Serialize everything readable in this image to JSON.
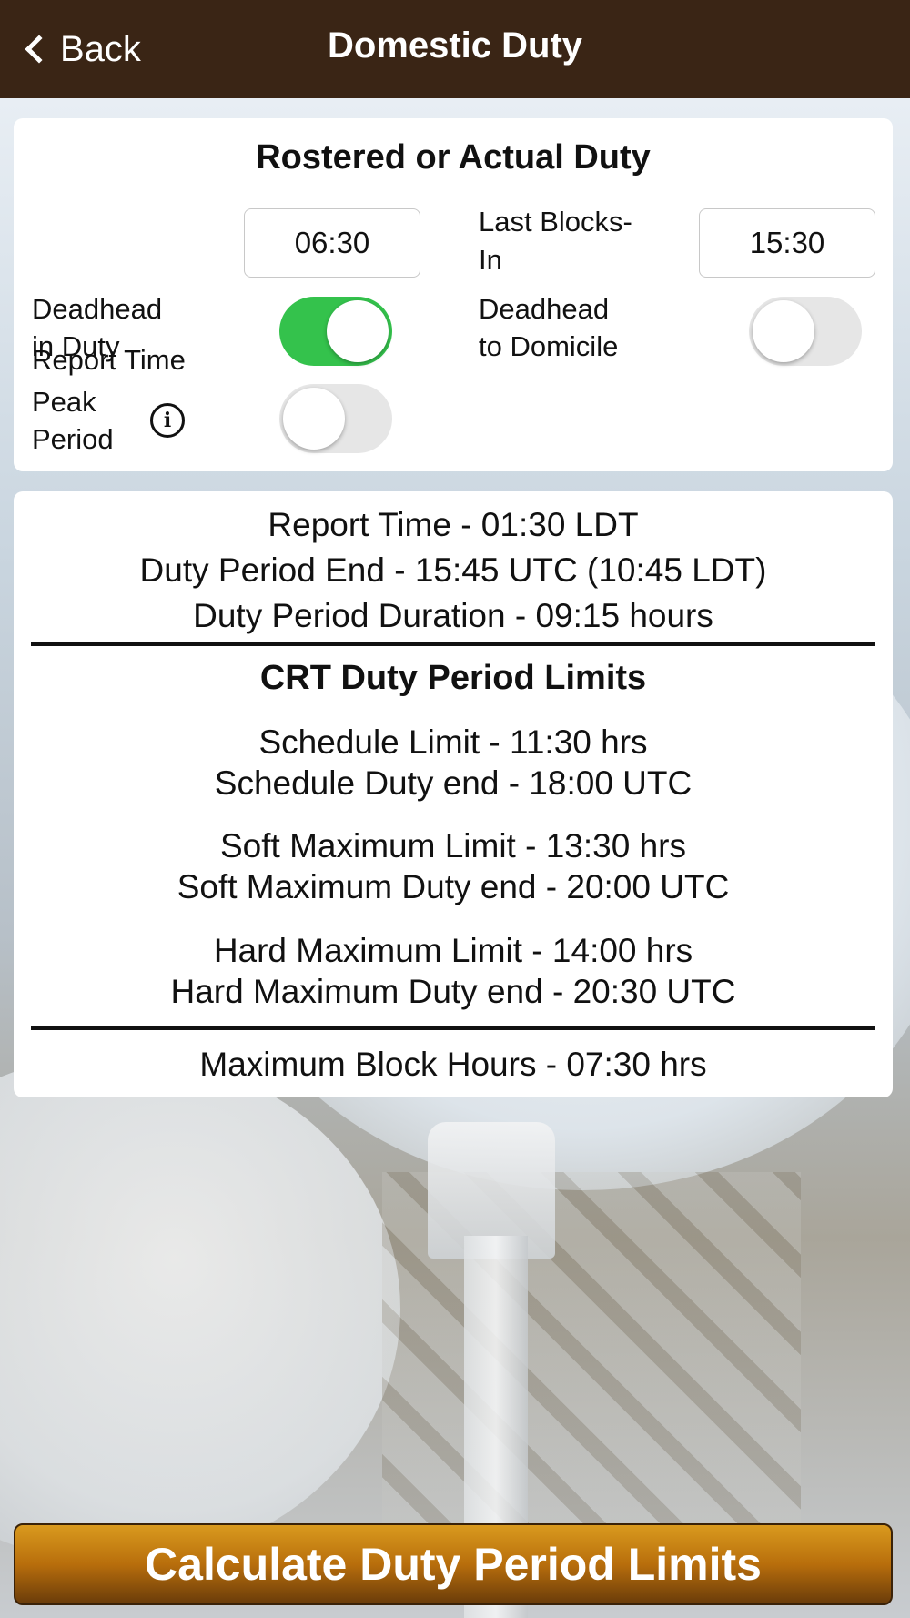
{
  "nav": {
    "back_label": "Back",
    "title": "Domestic Duty"
  },
  "input_card": {
    "title": "Rostered or Actual Duty",
    "report_time_label": "Report Time",
    "report_time_value": "06:30",
    "last_blocks_in_label_1": "Last Blocks-",
    "last_blocks_in_label_2": "In",
    "last_blocks_in_value": "15:30",
    "deadhead_in_duty_label_1": "Deadhead",
    "deadhead_in_duty_label_2": "in Duty",
    "deadhead_in_duty_on": true,
    "deadhead_to_domicile_label_1": "Deadhead",
    "deadhead_to_domicile_label_2": "to Domicile",
    "deadhead_to_domicile_on": false,
    "peak_period_label_1": "Peak",
    "peak_period_label_2": "Period",
    "peak_period_on": false,
    "info_icon_glyph": "i"
  },
  "results": {
    "report_time": "Report Time - 01:30 LDT",
    "duty_period_end": "Duty Period End - 15:45 UTC (10:45 LDT)",
    "duty_period_duration": "Duty Period Duration - 09:15 hours",
    "limits_title": "CRT Duty Period Limits",
    "schedule_limit": "Schedule Limit - 11:30 hrs",
    "schedule_duty_end": "Schedule Duty end - 18:00 UTC",
    "soft_max_limit": "Soft Maximum Limit - 13:30 hrs",
    "soft_max_duty_end": "Soft Maximum Duty end - 20:00 UTC",
    "hard_max_limit": "Hard Maximum Limit - 14:00 hrs",
    "hard_max_duty_end": "Hard Maximum Duty end - 20:30 UTC",
    "max_block_hours": "Maximum Block Hours - 07:30 hrs"
  },
  "calculate_button_label": "Calculate Duty Period Limits",
  "colors": {
    "nav_bar": "#3a2515",
    "toggle_on": "#34c24c",
    "button_top": "#d99a1e",
    "button_bottom": "#6a3c0a"
  }
}
